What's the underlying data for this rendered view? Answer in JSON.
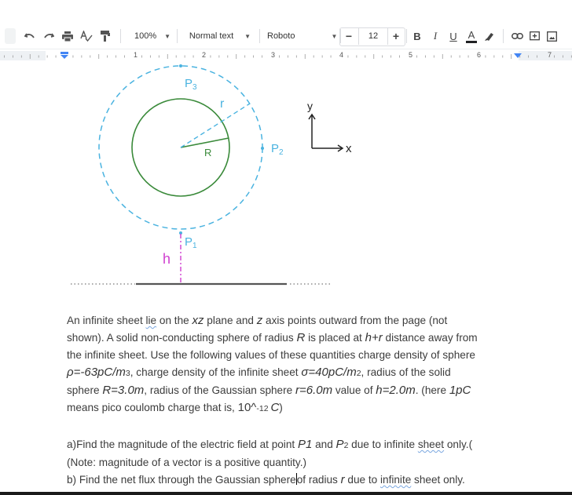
{
  "toolbar": {
    "zoom": "100%",
    "style": "Normal text",
    "font": "Roboto",
    "font_size": "12",
    "minus": "−",
    "plus": "+",
    "bold": "B",
    "italic": "I",
    "underline": "U",
    "text_color": "A",
    "text_color_value": "#202124"
  },
  "ruler": {
    "numbers": [
      "1",
      "2",
      "3",
      "4",
      "5",
      "6",
      "7"
    ]
  },
  "diagram": {
    "labels": {
      "p3": "P",
      "p3_sub": "3",
      "p2": "P",
      "p2_sub": "2",
      "p1": "P",
      "p1_sub": "1",
      "r_small": "r",
      "r_big": "R",
      "h": "h",
      "y_axis": "y",
      "x_axis": "x"
    },
    "colors": {
      "sphere": "#3a8a3a",
      "gaussian": "#4ab3e0",
      "height": "#d040d0",
      "sheet": "#555555"
    }
  },
  "paragraph1": {
    "l1a": "An infinite sheet ",
    "l1b": "lie",
    "l1c": " on the ",
    "l1d": "xz",
    "l1e": " plane and ",
    "l1f": "z",
    "l1g": " axis points outward from the page (not",
    "l2a": "shown). A solid non-conducting sphere of radius ",
    "l2b": "R",
    "l2c": " is placed at  ",
    "l2d": "h+r",
    "l2e": " distance away from",
    "l3": "the infinite sheet. Use the following values of these quantities charge density of sphere",
    "l4a": "ρ=-63pC/m",
    "l4b": "3",
    "l4c": ", charge density of the infinite sheet ",
    "l4d": "σ=40pC/m",
    "l4e": "2",
    "l4f": ", radius of the solid",
    "l5a": "sphere ",
    "l5b": "R=3.0m",
    "l5c": ", radius of the Gaussian sphere ",
    "l5d": "r=6.0m",
    "l5e": " value of  ",
    "l5f": "h=2.0m",
    "l5g": ". (here ",
    "l5h": "1pC",
    "l6a": "means pico coulomb charge that is, ",
    "l6b": "10^",
    "l6c": "-12 ",
    "l6d": "C",
    "l6e": ")"
  },
  "questions": {
    "a1a": "a)Find the magnitude of the electric field at point ",
    "a1b": "P1",
    "a1c": " and ",
    "a1d": "P",
    "a1e": "2",
    "a1f": "  due to infinite ",
    "a1g": "sheet",
    "a1h": " only.(",
    "a2": "(Note: magnitude of a vector is a positive quantity.)",
    "b1a": "b) Find the net flux through the Gaussian sphere",
    "b1b": "of radius ",
    "b1c": "r",
    "b1d": " due to ",
    "b1e": "infinite",
    "b1f": " sheet only."
  }
}
